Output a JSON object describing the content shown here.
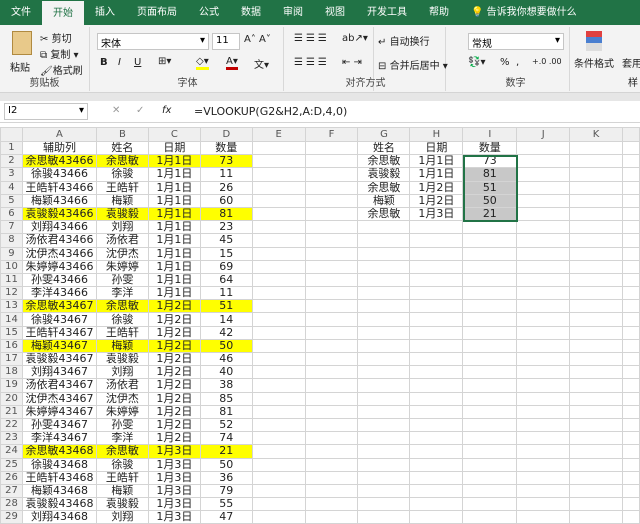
{
  "tabs": [
    "文件",
    "开始",
    "插入",
    "页面布局",
    "公式",
    "数据",
    "审阅",
    "视图",
    "开发工具",
    "帮助"
  ],
  "tell_me": "告诉我你想要做什么",
  "ribbon": {
    "clipboard": {
      "label": "剪贴板",
      "paste": "粘贴",
      "cut": "剪切",
      "copy": "复制",
      "format_painter": "格式刷"
    },
    "font": {
      "label": "字体",
      "font_name": "宋体",
      "font_size": "11",
      "bold": "B",
      "italic": "I",
      "underline": "U"
    },
    "alignment": {
      "label": "对齐方式",
      "wrap": "自动换行",
      "merge": "合并后居中"
    },
    "number": {
      "label": "数字",
      "format": "常规",
      "percent": "%",
      "comma": ","
    },
    "styles": {
      "conditional": "条件格式",
      "table": "套用表格格式",
      "label": "样"
    }
  },
  "formula_bar": {
    "cell_ref": "I2",
    "fx": "fx",
    "formula": "=VLOOKUP(G2&H2,A:D,4,0)"
  },
  "columns": [
    "A",
    "B",
    "C",
    "D",
    "E",
    "F",
    "G",
    "H",
    "I",
    "J",
    "K"
  ],
  "headers": {
    "A": "辅助列",
    "B": "姓名",
    "C": "日期",
    "D": "数量",
    "G": "姓名",
    "H": "日期",
    "I": "数量"
  },
  "rows": [
    [
      "余思敏43466",
      "余思敏",
      "1月1日",
      "73"
    ],
    [
      "徐骏43466",
      "徐骏",
      "1月1日",
      "11"
    ],
    [
      "王皓轩43466",
      "王皓轩",
      "1月1日",
      "26"
    ],
    [
      "梅颖43466",
      "梅颖",
      "1月1日",
      "60"
    ],
    [
      "袁骏毅43466",
      "袁骏毅",
      "1月1日",
      "81"
    ],
    [
      "刘翔43466",
      "刘翔",
      "1月1日",
      "23"
    ],
    [
      "汤依君43466",
      "汤依君",
      "1月1日",
      "45"
    ],
    [
      "沈伊杰43466",
      "沈伊杰",
      "1月1日",
      "15"
    ],
    [
      "朱婷婷43466",
      "朱婷婷",
      "1月1日",
      "69"
    ],
    [
      "孙雯43466",
      "孙雯",
      "1月1日",
      "64"
    ],
    [
      "李洋43466",
      "李洋",
      "1月1日",
      "11"
    ],
    [
      "余思敏43467",
      "余思敏",
      "1月2日",
      "51"
    ],
    [
      "徐骏43467",
      "徐骏",
      "1月2日",
      "14"
    ],
    [
      "王皓轩43467",
      "王皓轩",
      "1月2日",
      "42"
    ],
    [
      "梅颖43467",
      "梅颖",
      "1月2日",
      "50"
    ],
    [
      "袁骏毅43467",
      "袁骏毅",
      "1月2日",
      "46"
    ],
    [
      "刘翔43467",
      "刘翔",
      "1月2日",
      "40"
    ],
    [
      "汤依君43467",
      "汤依君",
      "1月2日",
      "38"
    ],
    [
      "沈伊杰43467",
      "沈伊杰",
      "1月2日",
      "85"
    ],
    [
      "朱婷婷43467",
      "朱婷婷",
      "1月2日",
      "81"
    ],
    [
      "孙雯43467",
      "孙雯",
      "1月2日",
      "52"
    ],
    [
      "李洋43467",
      "李洋",
      "1月2日",
      "74"
    ],
    [
      "余思敏43468",
      "余思敏",
      "1月3日",
      "21"
    ],
    [
      "徐骏43468",
      "徐骏",
      "1月3日",
      "50"
    ],
    [
      "王皓轩43468",
      "王皓轩",
      "1月3日",
      "36"
    ],
    [
      "梅颖43468",
      "梅颖",
      "1月3日",
      "79"
    ],
    [
      "袁骏毅43468",
      "袁骏毅",
      "1月3日",
      "55"
    ],
    [
      "刘翔43468",
      "刘翔",
      "1月3日",
      "47"
    ]
  ],
  "highlighted_rows": [
    2,
    6,
    13,
    16,
    24
  ],
  "lookup": [
    [
      "余思敏",
      "1月1日",
      "73"
    ],
    [
      "袁骏毅",
      "1月1日",
      "81"
    ],
    [
      "余思敏",
      "1月2日",
      "51"
    ],
    [
      "梅颖",
      "1月2日",
      "50"
    ],
    [
      "余思敏",
      "1月3日",
      "21"
    ]
  ],
  "colors": {
    "accent": "#217346",
    "highlight": "#ffff00"
  }
}
